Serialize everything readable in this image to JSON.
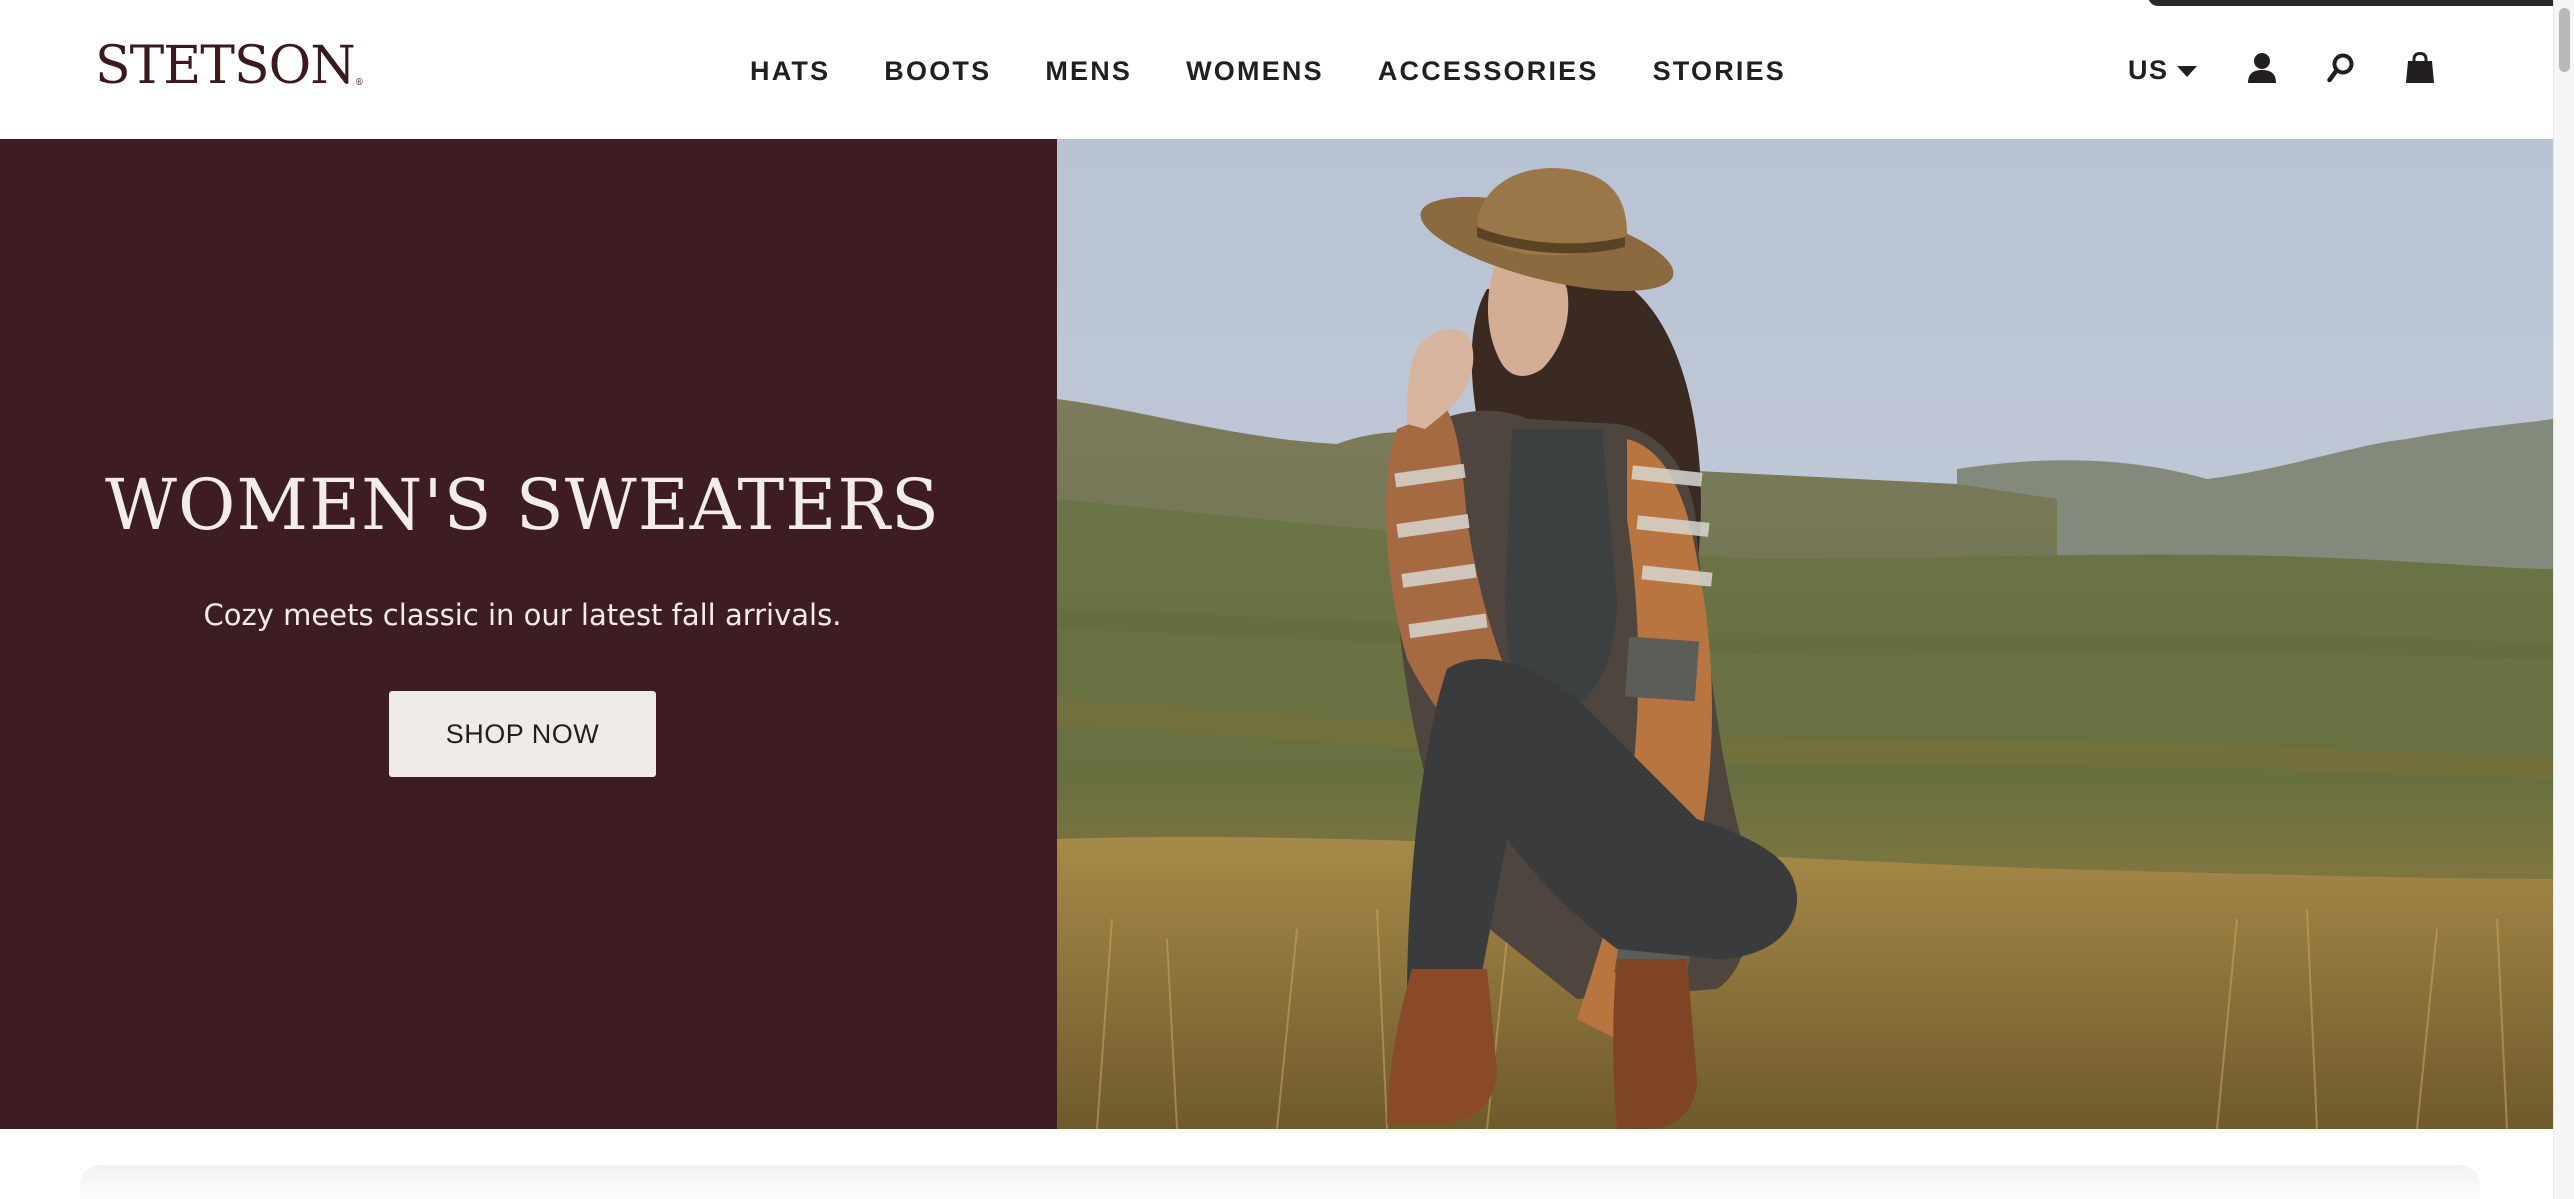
{
  "header": {
    "logo": "STETSON",
    "logo_mark": "®",
    "nav": [
      {
        "label": "HATS"
      },
      {
        "label": "BOOTS"
      },
      {
        "label": "MENS"
      },
      {
        "label": "WOMENS"
      },
      {
        "label": "ACCESSORIES"
      },
      {
        "label": "STORIES"
      }
    ],
    "country": "US",
    "icons": [
      "account-icon",
      "search-icon",
      "shopping-bag-icon"
    ]
  },
  "hero": {
    "title": "WOMEN'S SWEATERS",
    "subtitle": "Cozy meets classic in our latest fall arrivals.",
    "cta": "SHOP NOW",
    "image_alt": "Woman in a tan felt hat and patterned cardigan crouching in a grassy mountain meadow",
    "slides_total": 3,
    "active_slide": 3
  },
  "colors": {
    "brand": "#3b1a1e",
    "hero_panel": "#3d1d21",
    "hero_text": "#f2ede8",
    "cta_bg": "#efebe7",
    "nav_text": "#231f20"
  }
}
